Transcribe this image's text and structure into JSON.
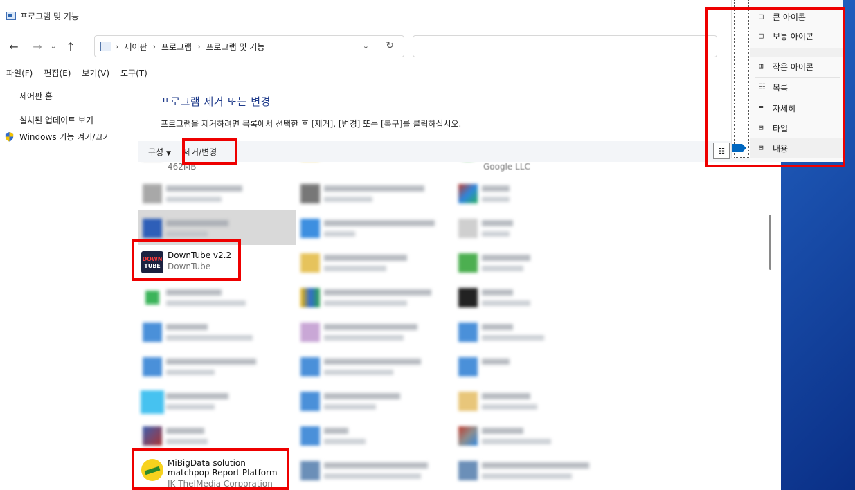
{
  "window": {
    "title": "프로그램 및 기능"
  },
  "address": {
    "crumbs": [
      "제어판",
      "프로그램",
      "프로그램 및 기능"
    ]
  },
  "menubar": {
    "items": [
      "파일(F)",
      "편집(E)",
      "보기(V)",
      "도구(T)"
    ]
  },
  "sidebar": {
    "home": "제어판 홈",
    "updates": "설치된 업데이트 보기",
    "features": "Windows 기능 켜기/끄기"
  },
  "main": {
    "heading": "프로그램 제거 또는 변경",
    "description": "프로그램을 제거하려면 목록에서 선택한 후 [제거], [변경] 또는 [복구]를 클릭하십시오.",
    "organize_label": "구성",
    "uninstall_label": "제거/변경"
  },
  "programs": {
    "top_partial_size": "462MB",
    "top_partial_right": "Google LLC",
    "downtube": {
      "name": "DownTube v2.2",
      "publisher": "DownTube"
    },
    "mibig": {
      "name": "MiBigData solution matchpop Report Platform",
      "publisher": "JK TheIMedia Corporation"
    }
  },
  "icons": {
    "downtube_top": "DOWN",
    "downtube_bottom": "TUBE"
  },
  "view_menu": {
    "items": [
      "큰 아이콘",
      "보통 아이콘",
      "작은 아이콘",
      "목록",
      "자세히",
      "타일",
      "내용"
    ]
  },
  "colors": {
    "highlight": "#ee0000",
    "heading": "#1e3a8a",
    "accent": "#0067c0"
  }
}
